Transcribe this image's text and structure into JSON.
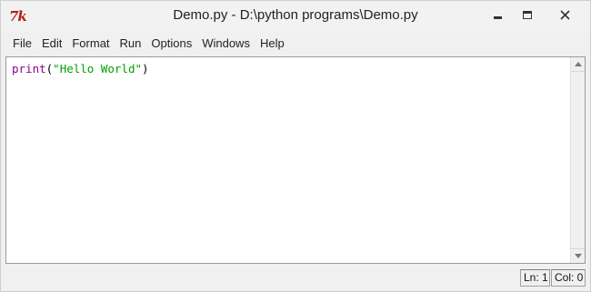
{
  "window": {
    "title": "Demo.py - D:\\python programs\\Demo.py",
    "icon_name": "idle-tk-icon",
    "icon_glyph": "7k"
  },
  "menu": [
    {
      "label": "File"
    },
    {
      "label": "Edit"
    },
    {
      "label": "Format"
    },
    {
      "label": "Run"
    },
    {
      "label": "Options"
    },
    {
      "label": "Windows"
    },
    {
      "label": "Help"
    }
  ],
  "editor": {
    "code": {
      "keyword": "print",
      "open_paren": "(",
      "string": "\"Hello World\"",
      "close_paren": ")"
    },
    "colors": {
      "keyword": "#900090",
      "string": "#00a000"
    }
  },
  "status": {
    "line": "Ln: 1",
    "column": "Col: 0"
  }
}
